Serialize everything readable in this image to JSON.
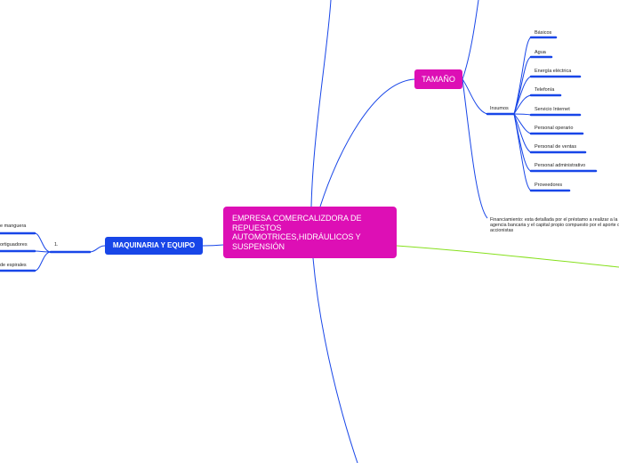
{
  "central": {
    "title": "EMPRESA COMERCALIZDORA DE REPUESTOS AUTOMOTRICES,HIDRÁULICOS Y SUSPENSIÓN"
  },
  "tamano": {
    "title": "TAMAÑO",
    "insumos": {
      "label": "Insumos",
      "items": [
        "Básicos",
        "Agua",
        "Energía eléctrica",
        "Telefonía",
        "Servicio Internet",
        "Personal operario",
        "Personal de ventas",
        "Personal administrativo",
        "Proveedores"
      ]
    },
    "financiamiento": "Financiamiento: esta detallada por el préstamo a realizar a la agencia bancaria y el capital propio compuesto por el aporte de accionistas"
  },
  "maquinaria": {
    "title": "MAQUINARIA Y EQUIPO",
    "number": "1.",
    "items": [
      "e manguera",
      "ortiguadores",
      "de espirales"
    ]
  },
  "colors": {
    "magenta": "#dd0fb5",
    "blue": "#1846e8",
    "green": "#86e01c"
  }
}
